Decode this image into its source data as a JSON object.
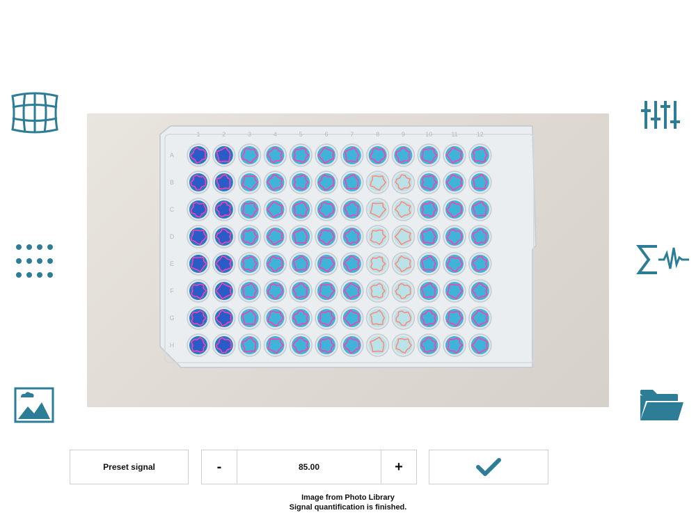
{
  "colors": {
    "accent": "#2e7d96",
    "outline_pink": "#ff3fae",
    "well_blue": "#1f78c8",
    "well_cyan": "#40b4d8"
  },
  "icons": {
    "left": [
      "grid-warp-icon",
      "dot-grid-icon",
      "image-icon"
    ],
    "right": [
      "sliders-icon",
      "sigma-signal-icon",
      "folder-icon"
    ]
  },
  "plate": {
    "column_labels": [
      "1",
      "2",
      "3",
      "4",
      "5",
      "6",
      "7",
      "8",
      "9",
      "10",
      "11",
      "12"
    ],
    "row_labels": [
      "A",
      "B",
      "C",
      "D",
      "E",
      "F",
      "G",
      "H"
    ]
  },
  "controls": {
    "preset_label": "Preset signal",
    "minus_label": "-",
    "value": "85.00",
    "plus_label": "+"
  },
  "status": {
    "line1": "Image from Photo Library",
    "line2": "Signal quantification is finished."
  }
}
